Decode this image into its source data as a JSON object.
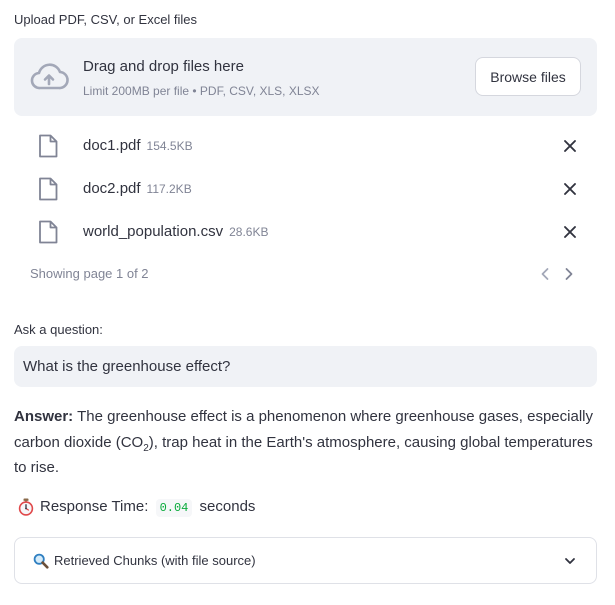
{
  "upload": {
    "label": "Upload PDF, CSV, or Excel files",
    "dropzone_title": "Drag and drop files here",
    "dropzone_subtitle": "Limit 200MB per file • PDF, CSV, XLS, XLSX",
    "browse_label": "Browse files",
    "icons": {
      "upload": "cloud-upload-icon",
      "file": "file-icon",
      "remove": "close-icon"
    },
    "files": [
      {
        "name": "doc1.pdf",
        "size": "154.5KB"
      },
      {
        "name": "doc2.pdf",
        "size": "117.2KB"
      },
      {
        "name": "world_population.csv",
        "size": "28.6KB"
      }
    ],
    "pagination": {
      "text": "Showing page 1 of 2",
      "current": 1,
      "total": 2
    }
  },
  "question": {
    "label": "Ask a question:",
    "value": "What is the greenhouse effect?"
  },
  "answer": {
    "prefix": "Answer:",
    "text_before_sub": " The greenhouse effect is a phenomenon where greenhouse gases, especially carbon dioxide (CO",
    "subscript": "2",
    "text_after_sub": "), trap heat in the Earth's atmosphere, causing global temperatures to rise."
  },
  "response": {
    "icon": "stopwatch-icon",
    "label": "Response Time:",
    "value": "0.04",
    "unit": "seconds"
  },
  "expander": {
    "icon": "magnifier-icon",
    "label": "Retrieved Chunks (with file source)"
  },
  "colors": {
    "background": "#ffffff",
    "panel": "#f0f2f6",
    "text": "#31333f",
    "muted": "#808495",
    "code_green": "#09ab3b"
  }
}
